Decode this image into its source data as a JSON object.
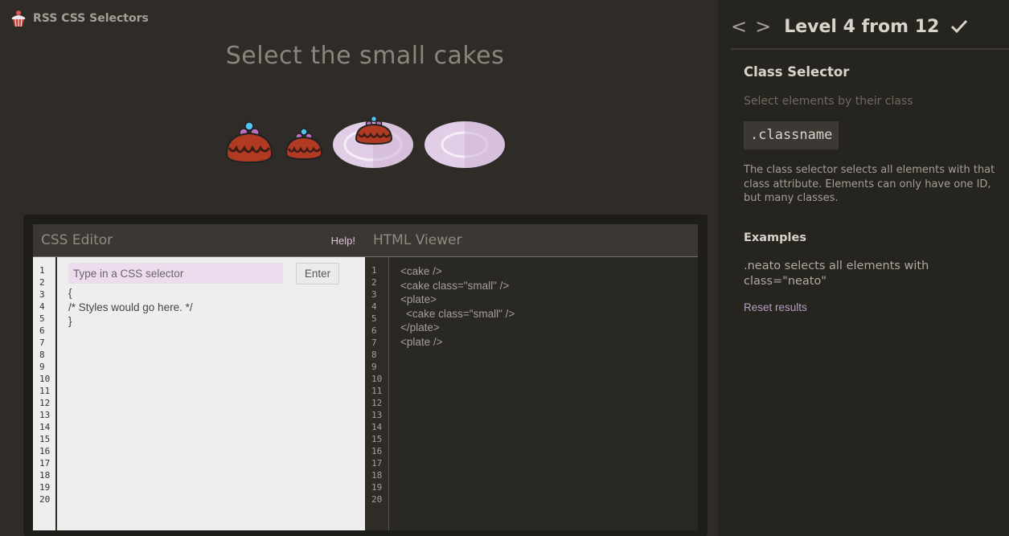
{
  "app": {
    "title": "RSS CSS Selectors"
  },
  "level": {
    "order_text": "Select the small cakes",
    "title": "Level 4 from 12",
    "prev_label": "<",
    "next_label": ">"
  },
  "table": {
    "items": [
      "cake",
      "cake-small",
      "plate-with-small-cake",
      "plate"
    ]
  },
  "css_editor": {
    "title": "CSS Editor",
    "help_label": "Help!",
    "input_placeholder": "Type in a CSS selector",
    "enter_label": "Enter",
    "lines": [
      "{",
      "/* Styles would go here. */",
      "}"
    ],
    "line_numbers": [
      "1",
      "2",
      "3",
      "4",
      "5",
      "6",
      "7",
      "8",
      "9",
      "10",
      "11",
      "12",
      "13",
      "14",
      "15",
      "16",
      "17",
      "18",
      "19",
      "20"
    ]
  },
  "html_viewer": {
    "title": "HTML Viewer",
    "lines": [
      {
        "text": "<cake />",
        "indent": 0
      },
      {
        "text": "<cake class=\"small\" />",
        "indent": 0
      },
      {
        "text": "<plate>",
        "indent": 0
      },
      {
        "text": "<cake class=\"small\" />",
        "indent": 1
      },
      {
        "text": "</plate>",
        "indent": 0
      },
      {
        "text": "<plate />",
        "indent": 0
      }
    ],
    "line_numbers": [
      "1",
      "2",
      "3",
      "4",
      "5",
      "6",
      "7",
      "8",
      "9",
      "10",
      "11",
      "12",
      "13",
      "14",
      "15",
      "16",
      "17",
      "18",
      "19",
      "20"
    ]
  },
  "sidebar": {
    "selector_name": "Class Selector",
    "selector_title": "Select elements by their class",
    "syntax": ".classname",
    "hint": "The class selector selects all elements with that class attribute. Elements can only have one ID, but many classes.",
    "examples_title": "Examples",
    "example_text": ".neato selects all elements with class=\"neato\"",
    "reset_label": "Reset results"
  },
  "colors": {
    "accent_purple": "#d8c3dd",
    "cake_brown": "#b03a22",
    "plate": "#e2cde6"
  }
}
